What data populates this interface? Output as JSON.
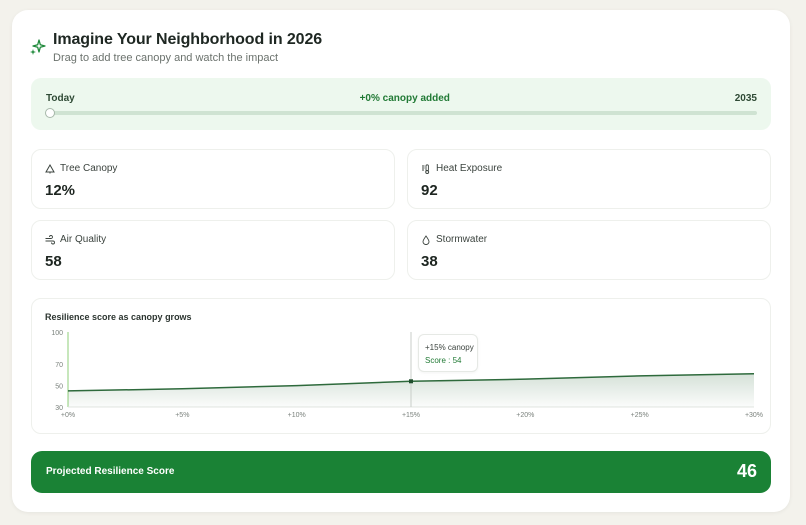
{
  "header": {
    "title": "Imagine Your Neighborhood in 2026",
    "subtitle": "Drag to add tree canopy and watch the impact",
    "icon": "sparkles-icon"
  },
  "slider": {
    "start_label": "Today",
    "status": "+0% canopy added",
    "end_label": "2035",
    "value": 0
  },
  "metrics": [
    {
      "label": "Tree Canopy",
      "value": "12%",
      "icon": "tree-icon"
    },
    {
      "label": "Heat Exposure",
      "value": "92",
      "icon": "thermometer-icon"
    },
    {
      "label": "Air Quality",
      "value": "58",
      "icon": "wind-icon"
    },
    {
      "label": "Stormwater",
      "value": "38",
      "icon": "droplet-icon"
    }
  ],
  "chart_data": {
    "type": "area",
    "title": "Resilience score as canopy grows",
    "x": [
      "+0%",
      "+5%",
      "+10%",
      "+15%",
      "+20%",
      "+25%",
      "+30%"
    ],
    "x_values": [
      0,
      5,
      10,
      15,
      20,
      25,
      30
    ],
    "series": [
      {
        "values": [
          45,
          47,
          50,
          54,
          56,
          59,
          61
        ]
      }
    ],
    "y_ticks": [
      30,
      50,
      70,
      100
    ],
    "ylim": [
      30,
      100
    ],
    "grid": false,
    "tooltip": {
      "x": 15,
      "label": "+15% canopy",
      "score_label": "Score : 54"
    }
  },
  "score": {
    "label": "Projected Resilience Score",
    "value": "46"
  },
  "colors": {
    "accent": "#1a8235",
    "line": "#2e6a3c",
    "panel": "#edf8ee"
  }
}
